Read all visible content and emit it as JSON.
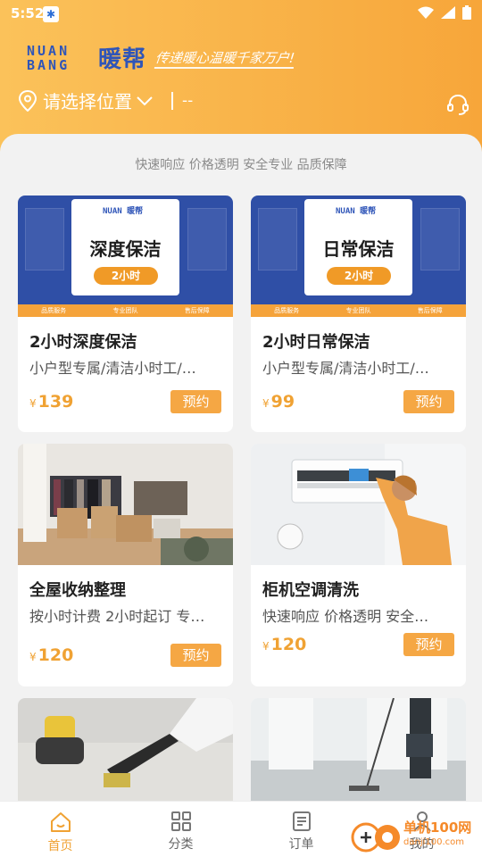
{
  "status_bar": {
    "time": "5:52"
  },
  "header": {
    "logo_lines": [
      "NUAN",
      "BANG"
    ],
    "logo_cn": "暖帮",
    "slogan": "传递暖心温暖千家万户!",
    "location": "请选择位置",
    "separator_text": "--"
  },
  "tagline": "快速响应 价格透明 安全专业 品质保障",
  "services": [
    {
      "title": "2小时深度保洁",
      "desc": "小户型专属/清洁小时工/…",
      "currency": "¥",
      "price": "139",
      "book": "预约",
      "banner": {
        "brand": "NUAN 暖帮",
        "headline": "深度保洁",
        "pill": "2小时",
        "strip": [
          "品质服务",
          "专业团队",
          "售后保障"
        ]
      }
    },
    {
      "title": "2小时日常保洁",
      "desc": "小户型专属/清洁小时工/…",
      "currency": "¥",
      "price": "99",
      "book": "预约",
      "banner": {
        "brand": "NUAN 暖帮",
        "headline": "日常保洁",
        "pill": "2小时",
        "strip": [
          "品质服务",
          "专业团队",
          "售后保障"
        ]
      }
    },
    {
      "title": "全屋收纳整理",
      "desc": "按小时计费 2小时起订 专…",
      "currency": "¥",
      "price": "120",
      "book": "预约"
    },
    {
      "title": "柜机空调清洗",
      "desc": "快速响应 价格透明 安全…",
      "currency": "¥",
      "price": "120",
      "book": "预约"
    }
  ],
  "nav": [
    {
      "label": "首页",
      "icon": "home-icon"
    },
    {
      "label": "分类",
      "icon": "grid-icon"
    },
    {
      "label": "订单",
      "icon": "order-list-icon"
    },
    {
      "label": "我的",
      "icon": "user-icon"
    }
  ],
  "watermark": {
    "text": "单机100网",
    "sub": "danji100.com"
  },
  "colors": {
    "accent": "#f5a744",
    "header_start": "#fbc25a",
    "header_end": "#f7a63a",
    "brand_blue": "#2f55b8"
  }
}
